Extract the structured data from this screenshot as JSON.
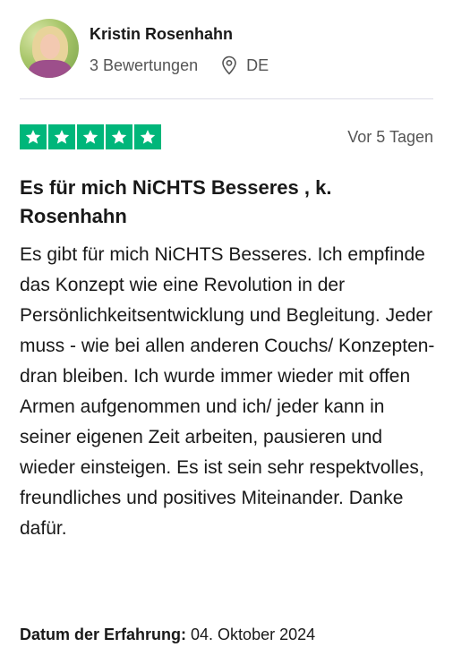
{
  "consumer": {
    "name": "Kristin Rosenhahn",
    "reviews_count": "3 Bewertungen",
    "country": "DE",
    "location_icon": "location-pin-icon"
  },
  "review": {
    "rating": 5,
    "rating_max": 5,
    "star_color": "#00b67a",
    "date": "Vor 5 Tagen",
    "title": "Es für mich NiCHTS Besseres , k. Rosenhahn",
    "body": "Es gibt für mich NiCHTS Besseres. Ich empfinde das Konzept wie eine Revolution in der Persönlichkeitsentwicklung und Begleitung. Jeder muss - wie bei allen anderen Couchs/ Konzepten- dran bleiben. Ich wurde immer wieder mit offen Armen aufgenommen und ich/ jeder kann in seiner eigenen Zeit arbeiten, pausieren und wieder einsteigen. Es ist sein sehr respektvolles, freundliches und positives Miteinander. Danke dafür.",
    "experience_label": "Datum der Erfahrung:",
    "experience_date": "04. Oktober 2024"
  }
}
